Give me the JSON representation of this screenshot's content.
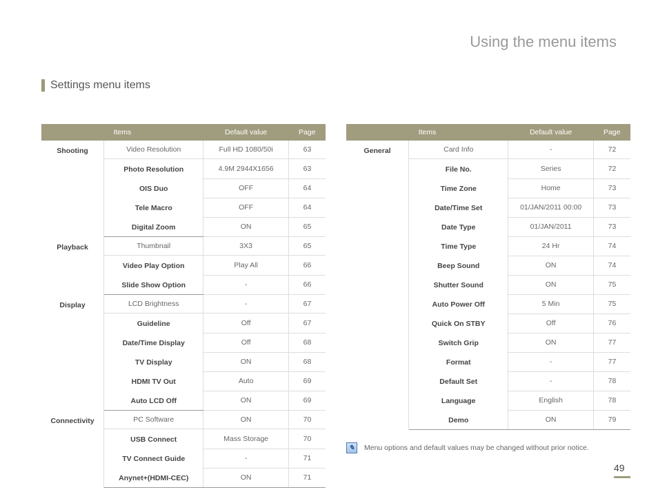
{
  "page": {
    "title": "Using the menu items",
    "section": "Settings menu items",
    "number": "49"
  },
  "headers": {
    "items": "Items",
    "default": "Default value",
    "page": "Page"
  },
  "left": {
    "rows": [
      {
        "cat": "Shooting",
        "item": "Video Resolution",
        "def": "Full HD  1080/50i",
        "page": "63"
      },
      {
        "cat": "",
        "item": "Photo Resolution",
        "def": "4.9M  2944X1656",
        "page": "63"
      },
      {
        "cat": "",
        "item": "OIS Duo",
        "def": "OFF",
        "page": "64"
      },
      {
        "cat": "",
        "item": "Tele Macro",
        "def": "OFF",
        "page": "64"
      },
      {
        "cat": "",
        "item": "Digital Zoom",
        "def": "ON",
        "page": "65"
      },
      {
        "cat": "Playback",
        "item": "Thumbnail",
        "def": "3X3",
        "page": "65"
      },
      {
        "cat": "",
        "item": "Video Play Option",
        "def": "Play All",
        "page": "66"
      },
      {
        "cat": "",
        "item": "Slide Show Option",
        "def": "-",
        "page": "66"
      },
      {
        "cat": "Display",
        "item": "LCD Brightness",
        "def": "-",
        "page": "67"
      },
      {
        "cat": "",
        "item": "Guideline",
        "def": "Off",
        "page": "67"
      },
      {
        "cat": "",
        "item": "Date/Time Display",
        "def": "Off",
        "page": "68"
      },
      {
        "cat": "",
        "item": "TV Display",
        "def": "ON",
        "page": "68"
      },
      {
        "cat": "",
        "item": "HDMI TV Out",
        "def": "Auto",
        "page": "69"
      },
      {
        "cat": "",
        "item": "Auto LCD Off",
        "def": "ON",
        "page": "69"
      },
      {
        "cat": "Connectivity",
        "item": "PC Software",
        "def": "ON",
        "page": "70"
      },
      {
        "cat": "",
        "item": "USB Connect",
        "def": "Mass Storage",
        "page": "70"
      },
      {
        "cat": "",
        "item": "TV Connect Guide",
        "def": "-",
        "page": "71"
      },
      {
        "cat": "",
        "item": "Anynet+(HDMI-CEC)",
        "def": "ON",
        "page": "71"
      }
    ],
    "cat_spans": [
      5,
      3,
      6,
      4
    ]
  },
  "right": {
    "rows": [
      {
        "cat": "General",
        "item": "Card Info",
        "def": "-",
        "page": "72"
      },
      {
        "cat": "",
        "item": "File No.",
        "def": "Series",
        "page": "72"
      },
      {
        "cat": "",
        "item": "Time Zone",
        "def": "Home",
        "page": "73"
      },
      {
        "cat": "",
        "item": "Date/Time Set",
        "def": "01/JAN/2011 00:00",
        "page": "73"
      },
      {
        "cat": "",
        "item": "Date Type",
        "def": "01/JAN/2011",
        "page": "73"
      },
      {
        "cat": "",
        "item": "Time Type",
        "def": "24 Hr",
        "page": "74"
      },
      {
        "cat": "",
        "item": "Beep Sound",
        "def": "ON",
        "page": "74"
      },
      {
        "cat": "",
        "item": "Shutter Sound",
        "def": "ON",
        "page": "75"
      },
      {
        "cat": "",
        "item": "Auto Power Off",
        "def": "5 Min",
        "page": "75"
      },
      {
        "cat": "",
        "item": "Quick On STBY",
        "def": "Off",
        "page": "76"
      },
      {
        "cat": "",
        "item": "Switch Grip",
        "def": "ON",
        "page": "77"
      },
      {
        "cat": "",
        "item": "Format",
        "def": "-",
        "page": "77"
      },
      {
        "cat": "",
        "item": "Default Set",
        "def": "-",
        "page": "78"
      },
      {
        "cat": "",
        "item": "Language",
        "def": "English",
        "page": "78"
      },
      {
        "cat": "",
        "item": "Demo",
        "def": "ON",
        "page": "79"
      }
    ],
    "cat_spans": [
      15
    ]
  },
  "note": "Menu options and default values may be changed without prior notice."
}
